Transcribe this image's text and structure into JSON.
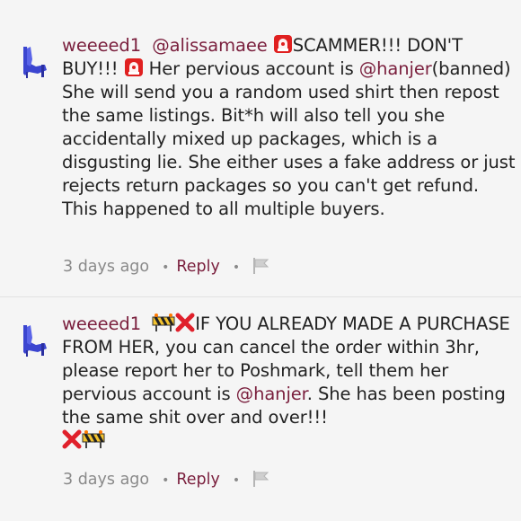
{
  "comments": [
    {
      "username": "weeeed1",
      "mention": "@alissamaee",
      "text_a": "SCAMMER!!! DON'T BUY!!!",
      "text_b": " Her pervious account is ",
      "mention2": "@hanjer",
      "text_c": "(banned) She will send you a random used shirt then repost the same listings. Bit*h will also tell you she accidentally mixed up packages, which is a disgusting lie. She either uses a fake address or just rejects return packages so you can't get refund. This happened to all multiple buyers.",
      "time": "3 days ago",
      "reply_label": "Reply",
      "icons": [
        "siren-icon",
        "siren-icon",
        "flag-icon"
      ]
    },
    {
      "username": "weeeed1",
      "text_a": "IF YOU ALREADY MADE A PURCHASE FROM HER, you can cancel the order within 3hr, please report her to Poshmark, tell them her pervious account is ",
      "mention": "@hanjer",
      "text_b": ". She has been posting the same shit over and over!!!",
      "time": "3 days ago",
      "reply_label": "Reply",
      "icons": [
        "construction-barrier-icon",
        "cross-mark-icon",
        "cross-mark-icon",
        "construction-barrier-icon",
        "flag-icon"
      ]
    }
  ],
  "colors": {
    "accent": "#7a1f3d",
    "meta": "#8a8a8a",
    "text": "#222222",
    "background": "#f5f5f5"
  }
}
